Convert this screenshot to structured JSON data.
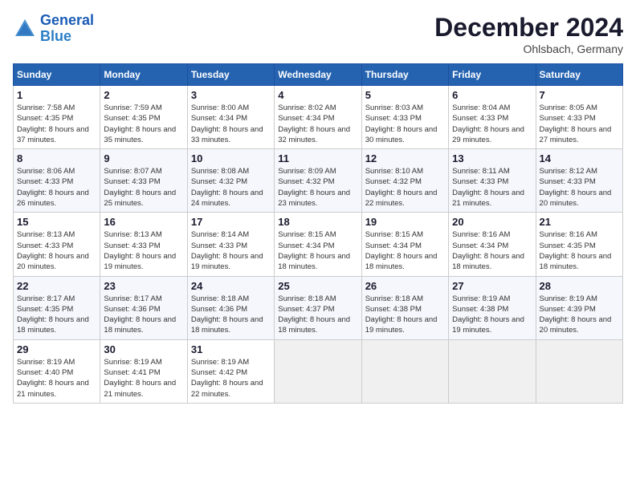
{
  "logo": {
    "line1": "General",
    "line2": "Blue"
  },
  "title": "December 2024",
  "location": "Ohlsbach, Germany",
  "days_of_week": [
    "Sunday",
    "Monday",
    "Tuesday",
    "Wednesday",
    "Thursday",
    "Friday",
    "Saturday"
  ],
  "weeks": [
    [
      {
        "day": "1",
        "info": "Sunrise: 7:58 AM\nSunset: 4:35 PM\nDaylight: 8 hours and 37 minutes."
      },
      {
        "day": "2",
        "info": "Sunrise: 7:59 AM\nSunset: 4:35 PM\nDaylight: 8 hours and 35 minutes."
      },
      {
        "day": "3",
        "info": "Sunrise: 8:00 AM\nSunset: 4:34 PM\nDaylight: 8 hours and 33 minutes."
      },
      {
        "day": "4",
        "info": "Sunrise: 8:02 AM\nSunset: 4:34 PM\nDaylight: 8 hours and 32 minutes."
      },
      {
        "day": "5",
        "info": "Sunrise: 8:03 AM\nSunset: 4:33 PM\nDaylight: 8 hours and 30 minutes."
      },
      {
        "day": "6",
        "info": "Sunrise: 8:04 AM\nSunset: 4:33 PM\nDaylight: 8 hours and 29 minutes."
      },
      {
        "day": "7",
        "info": "Sunrise: 8:05 AM\nSunset: 4:33 PM\nDaylight: 8 hours and 27 minutes."
      }
    ],
    [
      {
        "day": "8",
        "info": "Sunrise: 8:06 AM\nSunset: 4:33 PM\nDaylight: 8 hours and 26 minutes."
      },
      {
        "day": "9",
        "info": "Sunrise: 8:07 AM\nSunset: 4:33 PM\nDaylight: 8 hours and 25 minutes."
      },
      {
        "day": "10",
        "info": "Sunrise: 8:08 AM\nSunset: 4:32 PM\nDaylight: 8 hours and 24 minutes."
      },
      {
        "day": "11",
        "info": "Sunrise: 8:09 AM\nSunset: 4:32 PM\nDaylight: 8 hours and 23 minutes."
      },
      {
        "day": "12",
        "info": "Sunrise: 8:10 AM\nSunset: 4:32 PM\nDaylight: 8 hours and 22 minutes."
      },
      {
        "day": "13",
        "info": "Sunrise: 8:11 AM\nSunset: 4:33 PM\nDaylight: 8 hours and 21 minutes."
      },
      {
        "day": "14",
        "info": "Sunrise: 8:12 AM\nSunset: 4:33 PM\nDaylight: 8 hours and 20 minutes."
      }
    ],
    [
      {
        "day": "15",
        "info": "Sunrise: 8:13 AM\nSunset: 4:33 PM\nDaylight: 8 hours and 20 minutes."
      },
      {
        "day": "16",
        "info": "Sunrise: 8:13 AM\nSunset: 4:33 PM\nDaylight: 8 hours and 19 minutes."
      },
      {
        "day": "17",
        "info": "Sunrise: 8:14 AM\nSunset: 4:33 PM\nDaylight: 8 hours and 19 minutes."
      },
      {
        "day": "18",
        "info": "Sunrise: 8:15 AM\nSunset: 4:34 PM\nDaylight: 8 hours and 18 minutes."
      },
      {
        "day": "19",
        "info": "Sunrise: 8:15 AM\nSunset: 4:34 PM\nDaylight: 8 hours and 18 minutes."
      },
      {
        "day": "20",
        "info": "Sunrise: 8:16 AM\nSunset: 4:34 PM\nDaylight: 8 hours and 18 minutes."
      },
      {
        "day": "21",
        "info": "Sunrise: 8:16 AM\nSunset: 4:35 PM\nDaylight: 8 hours and 18 minutes."
      }
    ],
    [
      {
        "day": "22",
        "info": "Sunrise: 8:17 AM\nSunset: 4:35 PM\nDaylight: 8 hours and 18 minutes."
      },
      {
        "day": "23",
        "info": "Sunrise: 8:17 AM\nSunset: 4:36 PM\nDaylight: 8 hours and 18 minutes."
      },
      {
        "day": "24",
        "info": "Sunrise: 8:18 AM\nSunset: 4:36 PM\nDaylight: 8 hours and 18 minutes."
      },
      {
        "day": "25",
        "info": "Sunrise: 8:18 AM\nSunset: 4:37 PM\nDaylight: 8 hours and 18 minutes."
      },
      {
        "day": "26",
        "info": "Sunrise: 8:18 AM\nSunset: 4:38 PM\nDaylight: 8 hours and 19 minutes."
      },
      {
        "day": "27",
        "info": "Sunrise: 8:19 AM\nSunset: 4:38 PM\nDaylight: 8 hours and 19 minutes."
      },
      {
        "day": "28",
        "info": "Sunrise: 8:19 AM\nSunset: 4:39 PM\nDaylight: 8 hours and 20 minutes."
      }
    ],
    [
      {
        "day": "29",
        "info": "Sunrise: 8:19 AM\nSunset: 4:40 PM\nDaylight: 8 hours and 21 minutes."
      },
      {
        "day": "30",
        "info": "Sunrise: 8:19 AM\nSunset: 4:41 PM\nDaylight: 8 hours and 21 minutes."
      },
      {
        "day": "31",
        "info": "Sunrise: 8:19 AM\nSunset: 4:42 PM\nDaylight: 8 hours and 22 minutes."
      },
      null,
      null,
      null,
      null
    ]
  ]
}
